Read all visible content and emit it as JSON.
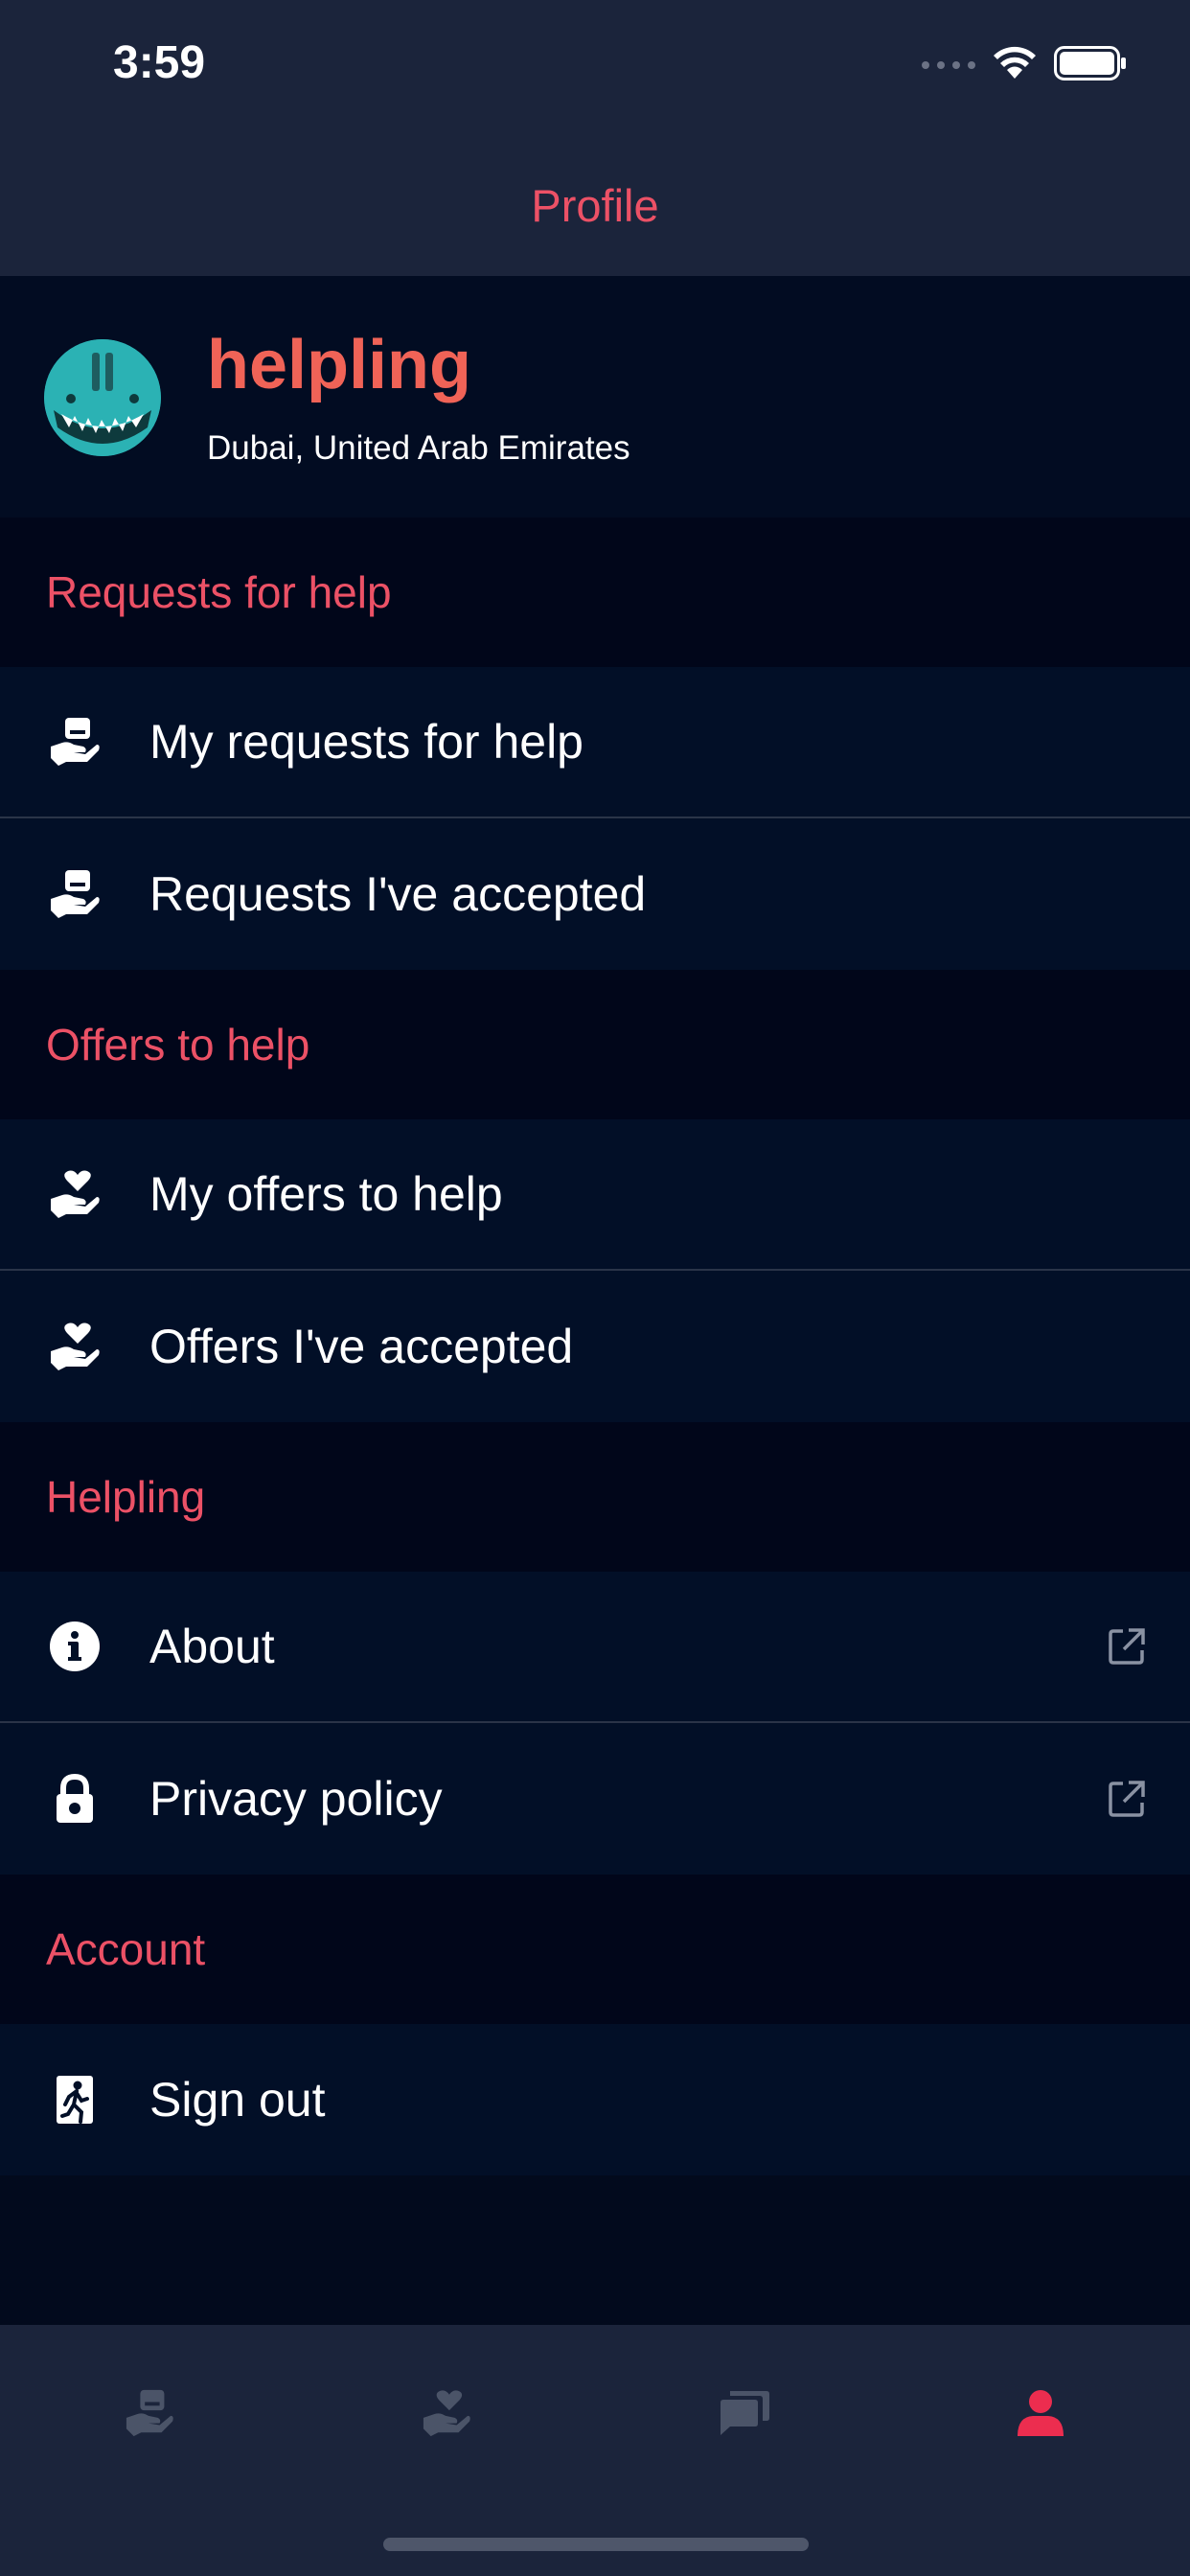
{
  "status": {
    "time": "3:59"
  },
  "header": {
    "title": "Profile"
  },
  "profile": {
    "name": "helpling",
    "location": "Dubai, United Arab Emirates"
  },
  "sections": [
    {
      "title": "Requests for help",
      "items": [
        {
          "label": "My requests for help",
          "icon": "hand-package-icon"
        },
        {
          "label": "Requests I've accepted",
          "icon": "hand-package-icon"
        }
      ]
    },
    {
      "title": "Offers to help",
      "items": [
        {
          "label": "My offers to help",
          "icon": "hand-heart-icon"
        },
        {
          "label": "Offers I've accepted",
          "icon": "hand-heart-icon"
        }
      ]
    },
    {
      "title": "Helpling",
      "items": [
        {
          "label": "About",
          "icon": "info-icon",
          "external": true
        },
        {
          "label": "Privacy policy",
          "icon": "lock-icon",
          "external": true
        }
      ]
    },
    {
      "title": "Account",
      "items": [
        {
          "label": "Sign out",
          "icon": "sign-out-icon"
        }
      ]
    }
  ],
  "tabs": [
    {
      "name": "requests",
      "icon": "hand-package-icon",
      "active": false
    },
    {
      "name": "offers",
      "icon": "hand-heart-icon",
      "active": false
    },
    {
      "name": "messages",
      "icon": "chat-icon",
      "active": false
    },
    {
      "name": "profile",
      "icon": "user-icon",
      "active": true
    }
  ],
  "colors": {
    "accent": "#ec5166",
    "name": "#f06357",
    "background": "#020a1d",
    "bar": "#1b243b",
    "inactive_tab": "#4b5468"
  }
}
